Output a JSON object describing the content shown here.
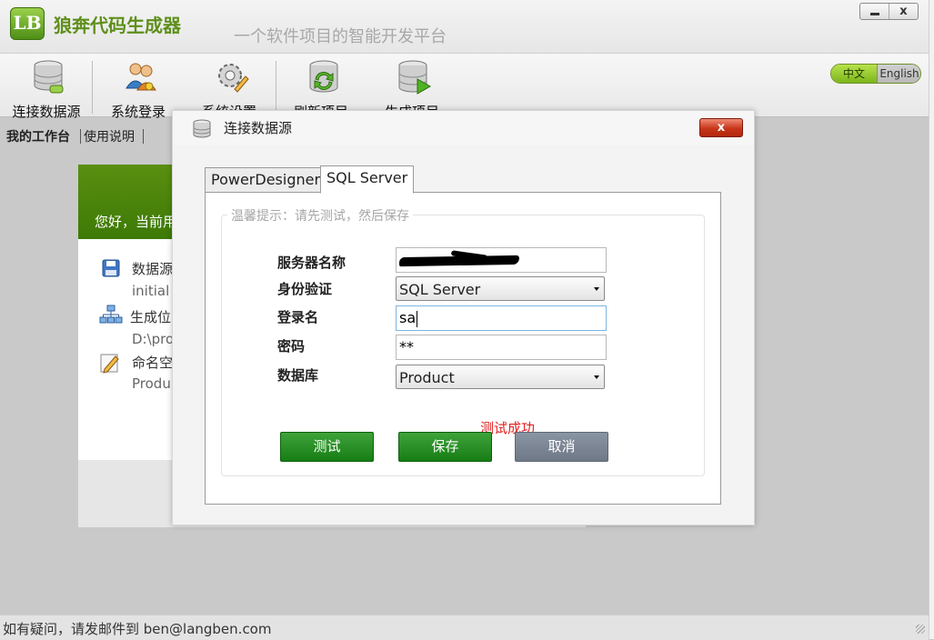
{
  "app": {
    "logo_text": "LB",
    "title": "狼奔代码生成器",
    "tagline": "一个软件项目的智能开发平台",
    "close_glyph": "x"
  },
  "toolbar": {
    "items": [
      {
        "label": "连接数据源",
        "icon": "database-connect-icon"
      },
      {
        "label": "系统登录",
        "icon": "users-key-icon"
      },
      {
        "label": "系统设置",
        "icon": "gear-pencil-icon"
      },
      {
        "label": "刷新项目",
        "icon": "database-refresh-icon"
      },
      {
        "label": "生成项目",
        "icon": "database-play-icon"
      }
    ],
    "lang": {
      "zh": "中文",
      "en": "English",
      "active": "zh"
    }
  },
  "page_tabs": [
    {
      "label": "我的工作台",
      "active": true
    },
    {
      "label": "使用说明",
      "active": false
    }
  ],
  "welcome": {
    "greeting": "您好，当前用",
    "items": [
      {
        "label": "数据源",
        "value": "initial",
        "icon": "save-disk-icon"
      },
      {
        "label": "生成位",
        "value": "D:\\pro",
        "icon": "sitemap-icon"
      },
      {
        "label": "命名空",
        "value": "Produ",
        "icon": "edit-note-icon"
      }
    ]
  },
  "dialog": {
    "title": "连接数据源",
    "close_glyph": "x",
    "tabs": [
      {
        "label": "PowerDesigner",
        "active": false
      },
      {
        "label": "SQL Server",
        "active": true
      }
    ],
    "hint": "温馨提示：请先测试，然后保存",
    "fields": {
      "server": {
        "label": "服务器名称",
        "value": ""
      },
      "auth": {
        "label": "身份验证",
        "selected": "SQL Server"
      },
      "login": {
        "label": "登录名",
        "value": "sa"
      },
      "password": {
        "label": "密码",
        "value": "**"
      },
      "database": {
        "label": "数据库",
        "selected": "Product"
      }
    },
    "status": "测试成功",
    "buttons": {
      "test": "测试",
      "save": "保存",
      "cancel": "取消"
    }
  },
  "statusbar": {
    "text": "如有疑问，请发邮件到 ben@langben.com"
  },
  "colors": {
    "brand_green": "#5e8f1a",
    "button_green": "#167d14",
    "cancel_gray": "#6e7886",
    "success_text": "#e02020",
    "close_red": "#c7351a"
  }
}
